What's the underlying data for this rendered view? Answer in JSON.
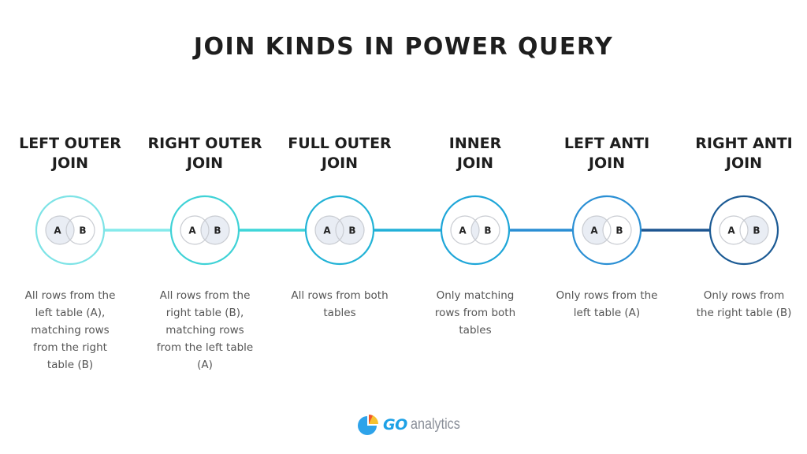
{
  "title": "JOIN KINDS IN POWER QUERY",
  "joins": [
    {
      "name_line1": "LEFT OUTER",
      "name_line2": "JOIN",
      "description": [
        "All rows from the",
        "left table (A),",
        "matching rows",
        "from the right",
        "table (B)"
      ],
      "highlight": "left-full",
      "ring_color": "#7de3e6",
      "label_a": "A",
      "label_b": "B"
    },
    {
      "name_line1": "RIGHT OUTER",
      "name_line2": "JOIN",
      "description": [
        "All rows from the",
        "right table (B),",
        "matching rows",
        "from the left table",
        "(A)"
      ],
      "highlight": "right-full",
      "ring_color": "#3fd2d6",
      "label_a": "A",
      "label_b": "B"
    },
    {
      "name_line1": "FULL OUTER",
      "name_line2": "JOIN",
      "description": [
        "All rows from both",
        "tables"
      ],
      "highlight": "both",
      "ring_color": "#22b3d6",
      "label_a": "A",
      "label_b": "B"
    },
    {
      "name_line1": "INNER",
      "name_line2": "JOIN",
      "description": [
        "Only matching",
        "rows from both",
        "tables"
      ],
      "highlight": "intersection",
      "ring_color": "#1ea6d8",
      "label_a": "A",
      "label_b": "B"
    },
    {
      "name_line1": "LEFT ANTI",
      "name_line2": "JOIN",
      "description": [
        "Only rows from the",
        "left table (A)"
      ],
      "highlight": "left-only",
      "ring_color": "#2a8fd4",
      "label_a": "A",
      "label_b": "B"
    },
    {
      "name_line1": "RIGHT ANTI",
      "name_line2": "JOIN",
      "description": [
        "Only rows from",
        "the right table (B)"
      ],
      "highlight": "right-only",
      "ring_color": "#1b5a94",
      "label_a": "A",
      "label_b": "B"
    }
  ],
  "connectors": [
    {
      "color": "#85eaeb"
    },
    {
      "color": "#3fd6d9"
    },
    {
      "color": "#22b0d8"
    },
    {
      "color": "#2a8ed4"
    },
    {
      "color": "#1d5591"
    }
  ],
  "colors": {
    "venn_fill": "#e9edf4",
    "venn_stroke": "#c9ccd2",
    "venn_label": "#222222"
  },
  "logo": {
    "brand_go": "GO",
    "brand_rest": "analytics",
    "pie_colors": [
      "#2ea3ea",
      "#f6c230",
      "#f0562d"
    ]
  }
}
